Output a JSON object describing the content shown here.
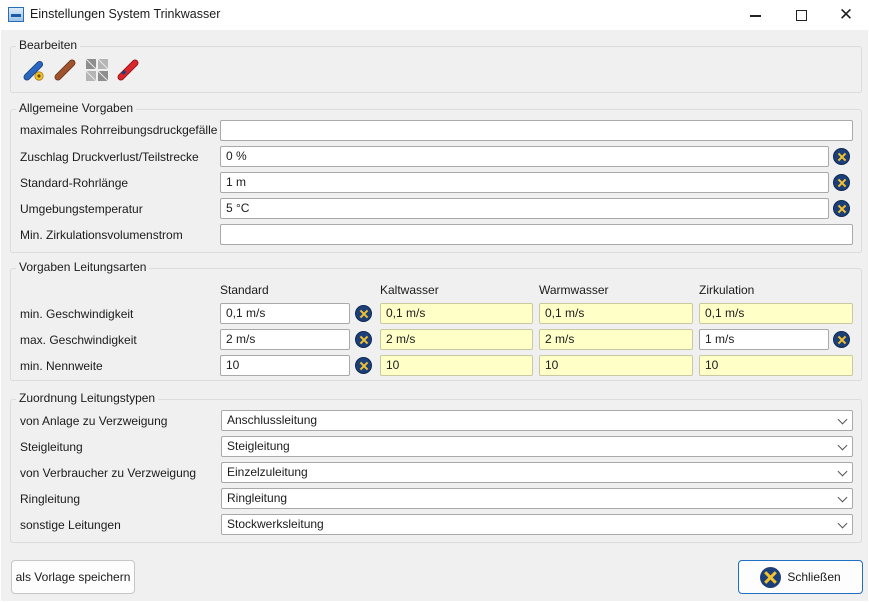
{
  "window": {
    "title": "Einstellungen System Trinkwasser",
    "buttons": {
      "minimize": "—",
      "maximize": "",
      "close": "✕"
    }
  },
  "bearbeiten": {
    "title": "Bearbeiten",
    "tools": [
      {
        "icon": "pipe-settings-icon"
      },
      {
        "icon": "pipe-brown-icon"
      },
      {
        "icon": "grid-pattern-icon"
      },
      {
        "icon": "pipe-red-icon"
      }
    ]
  },
  "allgemein": {
    "title": "Allgemeine Vorgaben",
    "rows": [
      {
        "label": "maximales Rohrreibungsdruckgefälle",
        "value": ""
      },
      {
        "label": "Zuschlag Druckverlust/Teilstrecke",
        "value": "0 %"
      },
      {
        "label": "Standard-Rohrlänge",
        "value": "1 m"
      },
      {
        "label": "Umgebungstemperatur",
        "value": "5 °C"
      },
      {
        "label": "Min. Zirkulationsvolumenstrom",
        "value": ""
      }
    ]
  },
  "vorgaben": {
    "title": "Vorgaben Leitungsarten",
    "columns": [
      "Standard",
      "Kaltwasser",
      "Warmwasser",
      "Zirkulation"
    ],
    "rows": [
      {
        "label": "min. Geschwindigkeit",
        "values": [
          "0,1 m/s",
          "0,1 m/s",
          "0,1 m/s",
          "0,1 m/s"
        ]
      },
      {
        "label": "max. Geschwindigkeit",
        "values": [
          "2 m/s",
          "2 m/s",
          "2 m/s",
          "1 m/s"
        ]
      },
      {
        "label": "min. Nennweite",
        "values": [
          "10",
          "10",
          "10",
          "10"
        ]
      }
    ]
  },
  "zuordnung": {
    "title": "Zuordnung Leitungstypen",
    "rows": [
      {
        "label": "von Anlage zu Verzweigung",
        "value": "Anschlussleitung"
      },
      {
        "label": "Steigleitung",
        "value": "Steigleitung"
      },
      {
        "label": "von Verbraucher zu Verzweigung",
        "value": "Einzelzuleitung"
      },
      {
        "label": "Ringleitung",
        "value": "Ringleitung"
      },
      {
        "label": "sonstige Leitungen",
        "value": "Stockwerksleitung"
      }
    ]
  },
  "footer": {
    "save_label": "als Vorlage speichern",
    "close_label": "Schließen"
  },
  "colors": {
    "accent": "#1f6fc5",
    "highlight_field": "#ffffc8",
    "clear_icon": "#1d3f77"
  }
}
